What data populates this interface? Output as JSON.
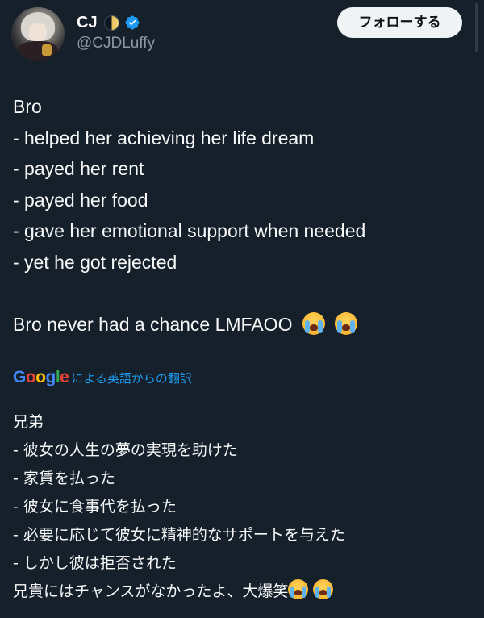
{
  "author": {
    "display_name": "CJ",
    "handle": "@CJDLuffy",
    "avatar_icon": "anime-avatar-icon",
    "status_icons": [
      "half-moon-icon",
      "verified-badge-icon"
    ],
    "verified_color": "#1d9bf0"
  },
  "follow_button": {
    "label": "フォローする"
  },
  "tweet": {
    "lines": [
      "Bro",
      "- helped her achieving her life dream",
      "- payed her rent",
      "- payed her food",
      "- gave her emotional support when needed",
      "- yet he got rejected"
    ],
    "closing": "Bro never had a chance LMFAOO",
    "closing_emoji": [
      "loudly-crying-face-icon",
      "loudly-crying-face-icon"
    ]
  },
  "translation": {
    "provider": "Google",
    "credit": "による英語からの翻訳",
    "lines": [
      "兄弟",
      "- 彼女の人生の夢の実現を助けた",
      "- 家賃を払った",
      "- 彼女に食事代を払った",
      "- 必要に応じて彼女に精神的なサポートを与えた",
      "- しかし彼は拒否された"
    ],
    "closing": "兄貴にはチャンスがなかったよ、大爆笑",
    "closing_emoji": [
      "loudly-crying-face-icon",
      "loudly-crying-face-icon"
    ]
  },
  "colors": {
    "background": "#15202b",
    "text": "#f7f9f9",
    "secondary_text": "#8b98a5",
    "link": "#1d9bf0",
    "button_bg": "#eff3f4"
  }
}
